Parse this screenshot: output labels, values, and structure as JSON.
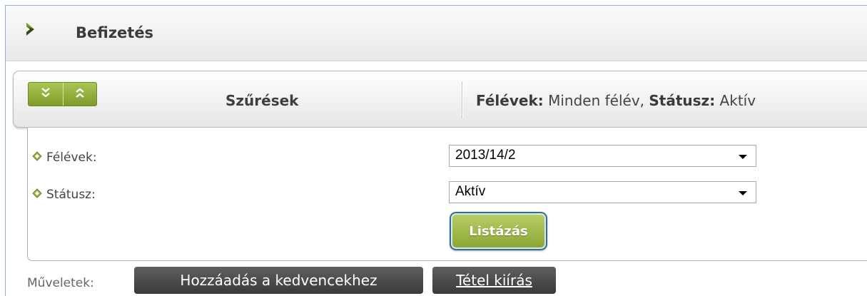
{
  "header": {
    "title": "Befizetés",
    "icon": "chevron-right-icon",
    "accent_color": "#7d9b25"
  },
  "filter_bar": {
    "expand_all_icon": "double-chevron-down-icon",
    "collapse_all_icon": "double-chevron-up-icon",
    "label": "Szűrések",
    "summary": {
      "semesters_key": "Félévek:",
      "semesters_value": " Minden félév, ",
      "status_key": "Státusz:",
      "status_value": " Aktív"
    }
  },
  "filters": [
    {
      "label": "Félévek:",
      "value": "2013/14/2"
    },
    {
      "label": "Státusz:",
      "value": "Aktív"
    }
  ],
  "list_button": "Listázás",
  "actions": {
    "label": "Műveletek:",
    "add_favorite": "Hozzáadás a kedvencekhez",
    "item_print": "Tétel kiírás"
  }
}
